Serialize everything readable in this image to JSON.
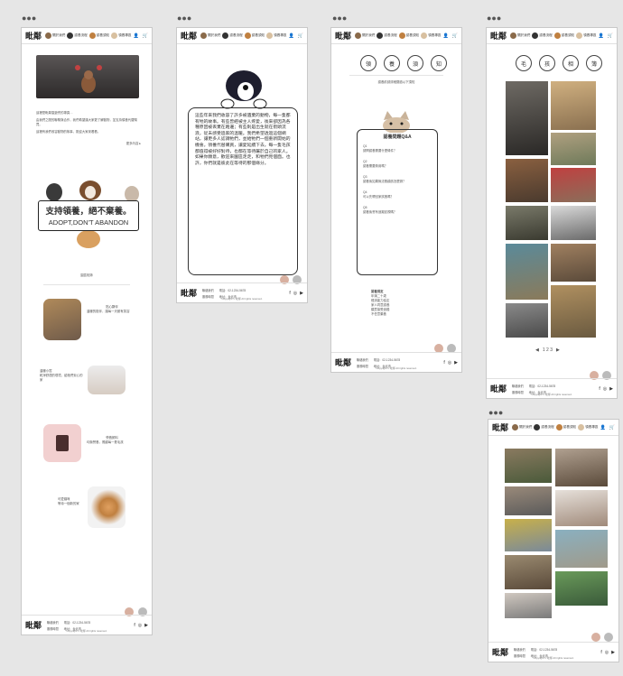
{
  "window_dots": "●●●",
  "header": {
    "logo": "毗鄰",
    "nav": [
      "關於我們",
      "認養流程",
      "認養須知",
      "領養專區"
    ],
    "user_icon": "user-icon",
    "cart_icon": "cart-icon"
  },
  "page1": {
    "intro_lines": [
      "這裡是毗鄰園遊會的專頁…",
      "由我們之間的聯繫與合作，我們希望讓大家更了解動物，並支持領養代替購買。",
      "這裡有我們收容動物的故事，歡迎大家來看看。"
    ],
    "more_link": "更多內容 ▸",
    "banner_zh": "支持領養，絕不棄養。",
    "banner_en": "ADOPT,DON'T ABANDON",
    "section_title": "園區相簿",
    "cards": [
      {
        "title": "貼心夥伴",
        "text": "溫暖的陪伴，讓每一天都有笑容"
      },
      {
        "title": "溫暖小窩",
        "text": "乾淨舒適的環境，給牠們安心的家"
      },
      {
        "title": "營養飼料",
        "text": "均衡營養，照顧每一隻毛孩"
      },
      {
        "title": "可愛貓咪",
        "text": "等待一個新的家"
      }
    ]
  },
  "page2": {
    "story": "這些年來我們收容了許多被遺棄的動物，每一隻都有牠的故事。有些曾經被主人疼愛，後來卻因為各種原因被丟棄在路邊；有些則是出生就在街頭流浪，從未感受過家的溫暖。我們希望透過這個網站，讓更多人認識牠們，並給牠們一個重新開始的機會。領養代替購買，讓愛延續下去。每一隻毛孩都值得被好好對待，也都在等待屬於自己的家人。如果你願意，歡迎來園區走走，和牠們見個面。也許，你們就是彼此在等待的那個緣分。"
  },
  "page3": {
    "title": [
      "領",
      "養",
      "須",
      "知"
    ],
    "lead": "認養前請詳細閱讀以下須知",
    "faq_heading": "認養問題Q&A",
    "faq": [
      {
        "q": "Q1",
        "a": "請問認養需要什麼條件？"
      },
      {
        "q": "Q2",
        "a": "認養需要費用嗎？"
      },
      {
        "q": "Q3",
        "a": "認養後如果無法照顧該怎麼辦？"
      },
      {
        "q": "Q4",
        "a": "可以先帶回家試養嗎？"
      },
      {
        "q": "Q5",
        "a": "認養後會有追蹤訪視嗎？"
      }
    ],
    "rules_heading": "認養規定",
    "rules": [
      "年滿二十歲",
      "經濟能力穩定",
      "家人同意認養",
      "願意接受追蹤",
      "不任意棄養"
    ]
  },
  "page4": {
    "title": [
      "毛",
      "孩",
      "相",
      "簿"
    ],
    "pager": "1 2 3"
  },
  "footer": {
    "items": [
      "聯絡我們",
      "服務時間",
      "電話：02-1234-5678",
      "地址：台北市"
    ],
    "copyright": "Copyright © 毗鄰 All rights reserved.",
    "social": [
      "f",
      "◎",
      "▶"
    ]
  },
  "colors": {
    "page_bg": "#e6e6e6",
    "frame_bg": "#ffffff",
    "banner_border": "#222222"
  }
}
